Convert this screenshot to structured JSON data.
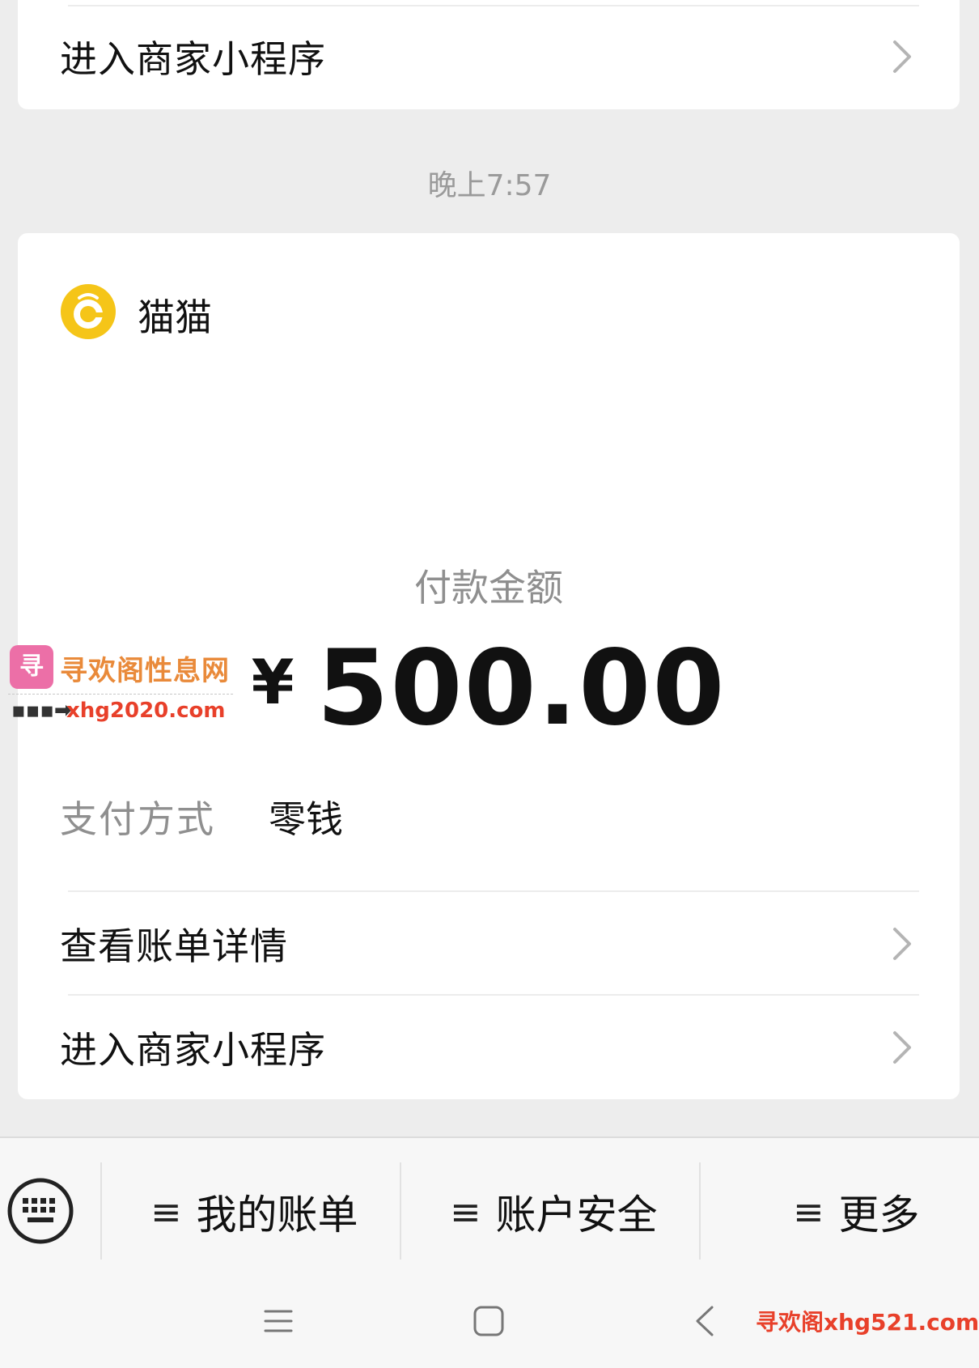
{
  "top_card": {
    "row_label": "进入商家小程序"
  },
  "timestamp": "晚上7:57",
  "main_card": {
    "merchant_name": "猫猫",
    "amount_label": "付款金额",
    "currency": "¥",
    "amount": "500.00",
    "pay_method_label": "支付方式",
    "pay_method_value": "零钱",
    "rows": [
      {
        "label": "查看账单详情"
      },
      {
        "label": "进入商家小程序"
      }
    ]
  },
  "watermark": {
    "logo_text": "寻",
    "title": "寻欢阁性息网",
    "arrow": "▪▪▪➡",
    "url": "xhg2020.com"
  },
  "bottom_menu": {
    "keyboard_icon": "keyboard-icon",
    "items": [
      {
        "label": "我的账单",
        "icon": "≡"
      },
      {
        "label": "账户安全",
        "icon": "≡"
      },
      {
        "label": "更多",
        "icon": "≡"
      }
    ]
  },
  "nav_bar": {
    "footer_watermark": "寻欢阁xhg521.com"
  },
  "colors": {
    "background": "#ededed",
    "card": "#ffffff",
    "logo_yellow": "#f5c518",
    "watermark_orange": "#e98a3a",
    "watermark_red": "#e8402a"
  }
}
